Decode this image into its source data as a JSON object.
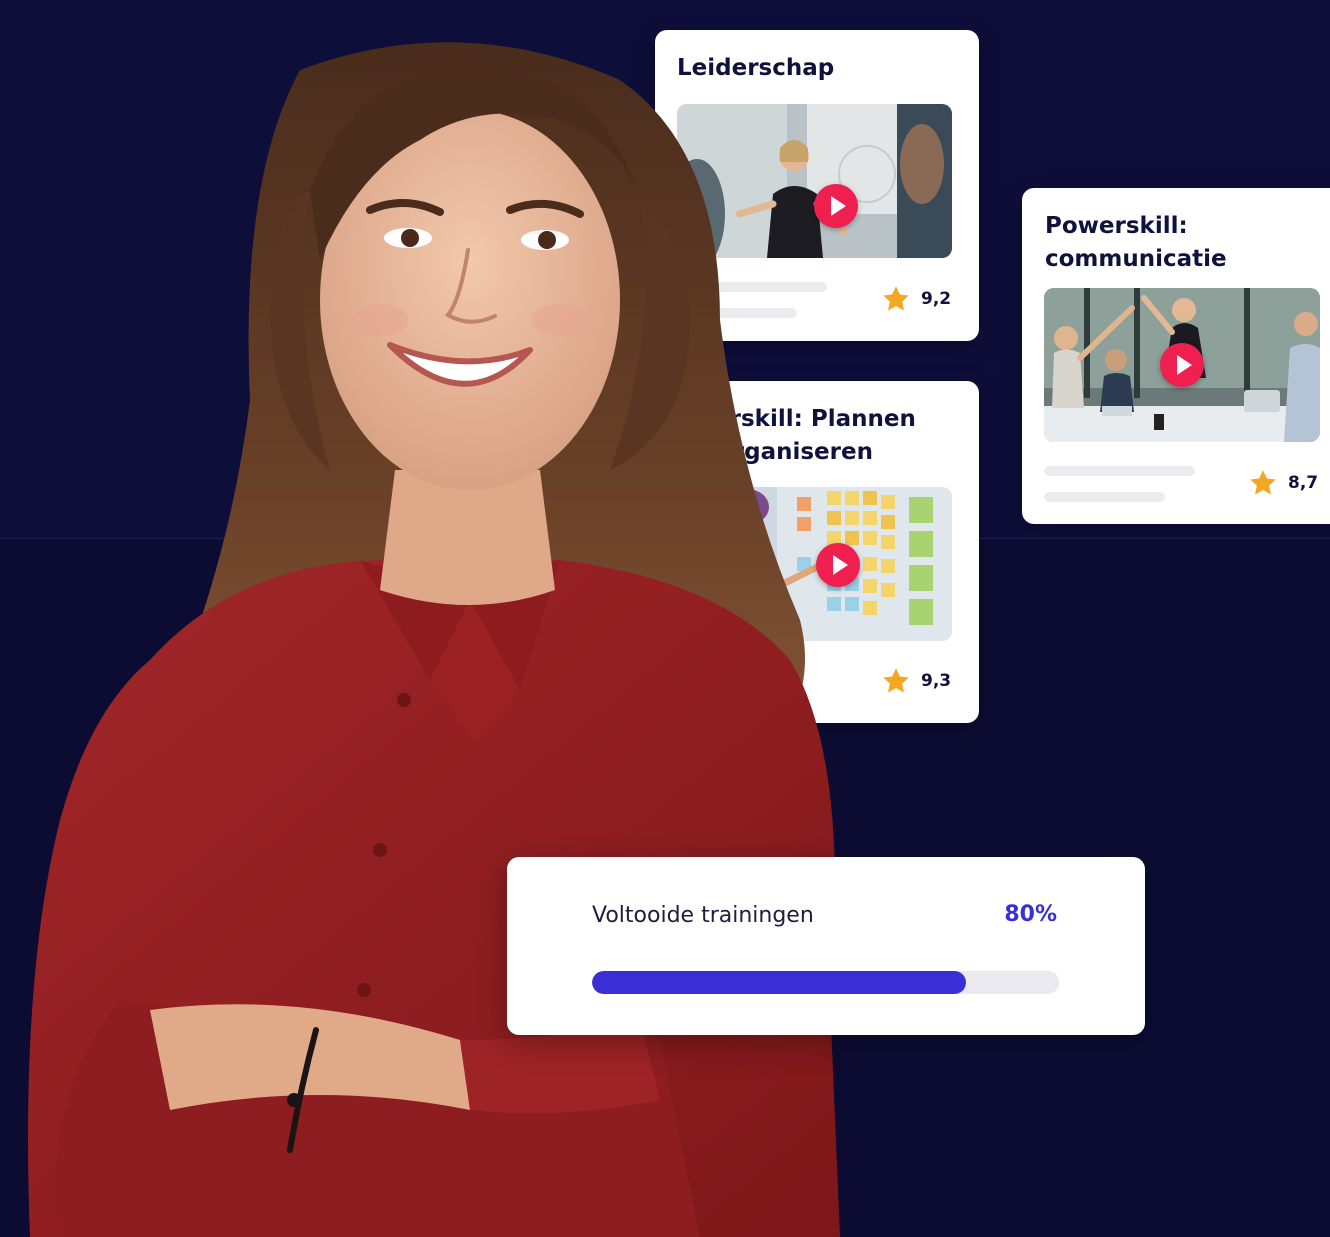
{
  "colors": {
    "background": "#0c0c33",
    "accent": "#3a2fd6",
    "play_button": "#ef1f4f",
    "star": "#f5a623",
    "card": "#ffffff"
  },
  "cards": [
    {
      "title": "Leiderschap",
      "rating": "9,2",
      "thumbnail": "presenter-at-whiteboard",
      "icon": "play-icon"
    },
    {
      "title": "owerskill: Plannen\nen organiseren",
      "rating": "9,3",
      "thumbnail": "sticky-notes-wall",
      "icon": "play-icon"
    },
    {
      "title": "Powerskill:\ncommunicatie",
      "rating": "8,7",
      "thumbnail": "team-high-five",
      "icon": "play-icon"
    }
  ],
  "progress": {
    "label": "Voltooide trainingen",
    "value_text": "80%",
    "fraction": 0.8
  }
}
